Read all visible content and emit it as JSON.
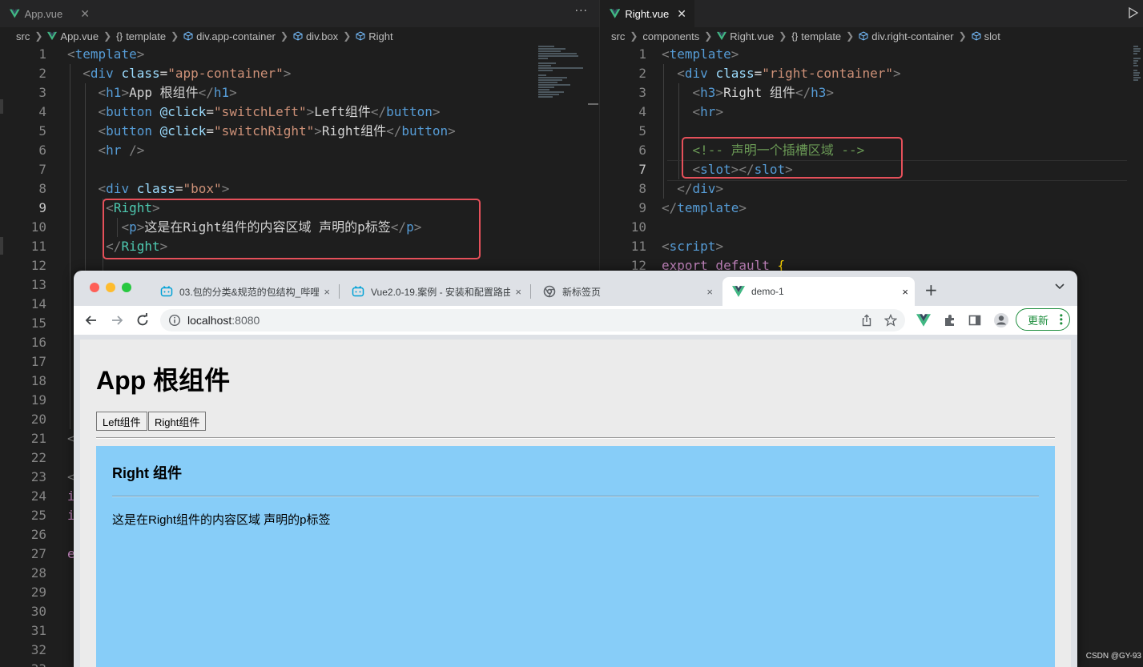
{
  "left_editor": {
    "tab_title": "App.vue",
    "more": "···",
    "breadcrumb": [
      "src",
      "App.vue",
      "template",
      "div.app-container",
      "div.box",
      "Right"
    ],
    "line_numbers": [
      "1",
      "2",
      "3",
      "4",
      "5",
      "6",
      "7",
      "8",
      "9",
      "10",
      "11",
      "12",
      "13",
      "14",
      "15",
      "16",
      "17",
      "18",
      "19",
      "20",
      "21",
      "22",
      "23",
      "24",
      "25",
      "26",
      "27",
      "28",
      "29",
      "30",
      "31",
      "32",
      "33"
    ],
    "code": {
      "l1_open": "<",
      "l1_tag": "template",
      "l1_close": ">",
      "l2_indent": "  ",
      "l2_open": "<",
      "l2_tag": "div",
      "l2_attr": " class",
      "l2_eq": "=",
      "l2_val": "\"app-container\"",
      "l2_close": ">",
      "l3_indent": "    ",
      "l3_open": "<",
      "l3_tag": "h1",
      "l3_close": ">",
      "l3_text": "App 根组件",
      "l3_end_open": "</",
      "l3_end_tag": "h1",
      "l3_end_close": ">",
      "l4_indent": "    ",
      "l4_open": "<",
      "l4_tag": "button",
      "l4_attr": " @click",
      "l4_eq": "=",
      "l4_val": "\"switchLeft\"",
      "l4_close": ">",
      "l4_text": "Left组件",
      "l4_end_open": "</",
      "l4_end_tag": "button",
      "l4_end_close": ">",
      "l5_indent": "    ",
      "l5_open": "<",
      "l5_tag": "button",
      "l5_attr": " @click",
      "l5_eq": "=",
      "l5_val": "\"switchRight\"",
      "l5_close": ">",
      "l5_text": "Right组件",
      "l5_end_open": "</",
      "l5_end_tag": "button",
      "l5_end_close": ">",
      "l6_indent": "    ",
      "l6_open": "<",
      "l6_tag": "hr",
      "l6_close": " />",
      "l8_indent": "    ",
      "l8_open": "<",
      "l8_tag": "div",
      "l8_attr": " class",
      "l8_eq": "=",
      "l8_val": "\"box\"",
      "l8_close": ">",
      "l9_indent": "     ",
      "l9_open": "<",
      "l9_tag": "Right",
      "l9_close": ">",
      "l10_indent": "       ",
      "l10_open": "<",
      "l10_tag": "p",
      "l10_close": ">",
      "l10_text": "这是在Right组件的内容区域 声明的p标签",
      "l10_end_open": "</",
      "l10_end_tag": "p",
      "l10_end_close": ">",
      "l11_indent": "     ",
      "l11_open": "</",
      "l11_tag": "Right",
      "l11_close": ">",
      "l21": "<",
      "l23": "<",
      "l24": "i",
      "l25": "i",
      "l27": "e"
    }
  },
  "right_editor": {
    "tab_title": "Right.vue",
    "breadcrumb": [
      "src",
      "components",
      "Right.vue",
      "template",
      "div.right-container",
      "slot"
    ],
    "line_numbers": [
      "1",
      "2",
      "3",
      "4",
      "5",
      "6",
      "7",
      "8",
      "9",
      "10",
      "11",
      "12"
    ],
    "code": {
      "l1_open": "<",
      "l1_tag": "template",
      "l1_close": ">",
      "l2_indent": "  ",
      "l2_open": "<",
      "l2_tag": "div",
      "l2_attr": " class",
      "l2_eq": "=",
      "l2_val": "\"right-container\"",
      "l2_close": ">",
      "l3_indent": "    ",
      "l3_open": "<",
      "l3_tag": "h3",
      "l3_close": ">",
      "l3_text": "Right 组件",
      "l3_end_open": "</",
      "l3_end_tag": "h3",
      "l3_end_close": ">",
      "l4_indent": "    ",
      "l4_open": "<",
      "l4_tag": "hr",
      "l4_close": ">",
      "l6_indent": "    ",
      "l6_comment": "<!-- 声明一个插槽区域 -->",
      "l7_indent": "    ",
      "l7_open": "<",
      "l7_tag": "slot",
      "l7_mid": "></",
      "l7_end_tag": "slot",
      "l7_close": ">",
      "l8_indent": "  ",
      "l8_open": "</",
      "l8_tag": "div",
      "l8_close": ">",
      "l9_open": "</",
      "l9_tag": "template",
      "l9_close": ">",
      "l11_open": "<",
      "l11_tag": "script",
      "l11_close": ">",
      "l12_kw": "export default ",
      "l12_brace": "{"
    }
  },
  "browser": {
    "tabs": [
      {
        "title": "03.包的分类&规范的包结构_哔哩",
        "close": "×"
      },
      {
        "title": "Vue2.0-19.案例 - 安装和配置路由",
        "close": "×"
      },
      {
        "title": "新标签页",
        "close": "×"
      },
      {
        "title": "demo-1",
        "close": "×"
      }
    ],
    "new_tab": "+",
    "url_host": "localhost",
    "url_port": ":8080",
    "update_label": "更新",
    "colors": {
      "update_green": "#1e8e3e",
      "box_blue": "#87cdf8",
      "vue_green": "#41b883",
      "bili_blue": "#00a1d6"
    }
  },
  "page": {
    "h1": "App 根组件",
    "buttons": [
      "Left组件",
      "Right组件"
    ],
    "right_component": {
      "h3": "Right 组件",
      "paragraph": "这是在Right组件的内容区域 声明的p标签"
    }
  },
  "watermark": "CSDN @GY-93"
}
